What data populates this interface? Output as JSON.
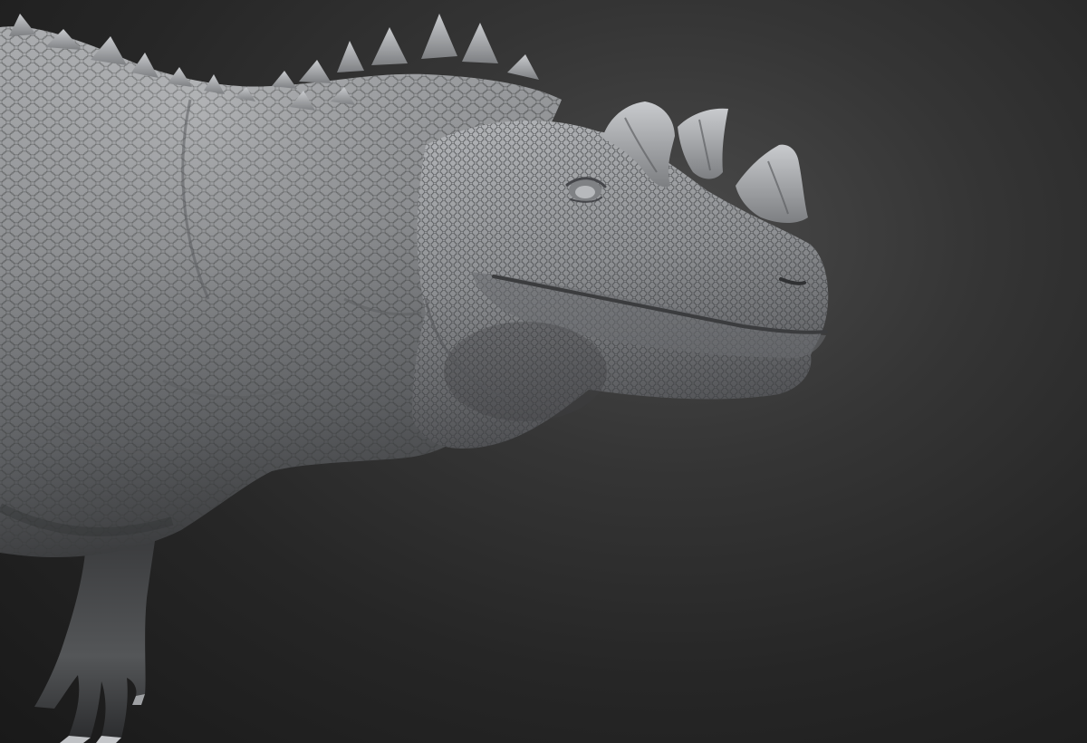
{
  "scene": {
    "subject": "dinosaur-sculpt",
    "background_color": "#2b2b2b",
    "material_color": "#8f9194"
  }
}
